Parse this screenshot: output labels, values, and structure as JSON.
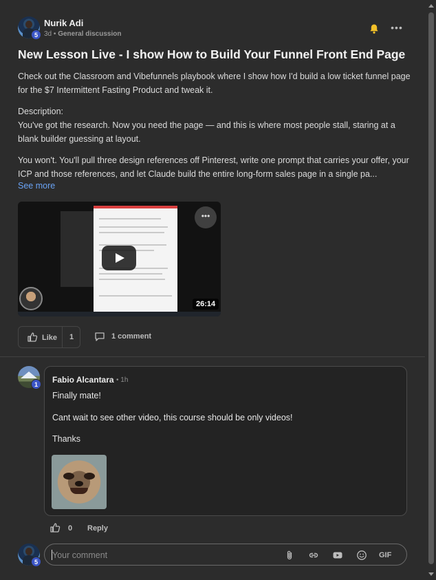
{
  "post": {
    "author": "Nurik Adi",
    "author_level": "5",
    "time": "3d",
    "separator": "•",
    "category": "General discussion",
    "title": "New Lesson Live - I show How to Build Your Funnel Front End Page",
    "paragraph1": "Check out the Classroom and Vibefunnels playbook where I show how I'd build a low ticket funnel page for the $7 Intermittent Fasting Product and tweak it.",
    "description_label": "Description:",
    "paragraph2": "You've got the research. Now you need the page — and this is where most people stall, staring at a blank builder guessing at layout.",
    "paragraph3": "You won't. You'll pull three design references off Pinterest, write one prompt that carries your offer, your ICP and those references, and let Claude build the entire long-form sales page in a single pa...",
    "see_more": "See more",
    "video_duration": "26:14",
    "video_menu": "•••",
    "like_label": "Like",
    "like_count": "1",
    "comment_count_label": "1 comment",
    "more_menu": "•••"
  },
  "comment": {
    "author": "Fabio Alcantara",
    "author_level": "1",
    "time": "• 1h",
    "line1": "Finally mate!",
    "line2": "Cant wait to see other video, this course should be only videos!",
    "line3": "Thanks",
    "like_count": "0",
    "reply_label": "Reply"
  },
  "composer": {
    "avatar_level": "5",
    "placeholder": "Your comment",
    "gif_label": "GIF"
  },
  "colors": {
    "background": "#2c2c2c",
    "accent_link": "#6aa3f5",
    "level_badge": "#3b55c6",
    "bell": "#f2c029"
  },
  "icons": [
    "bell-icon",
    "more-icon",
    "play-icon",
    "thumbs-up-icon",
    "comment-icon",
    "attachment-icon",
    "link-icon",
    "video-icon",
    "emoji-icon"
  ]
}
